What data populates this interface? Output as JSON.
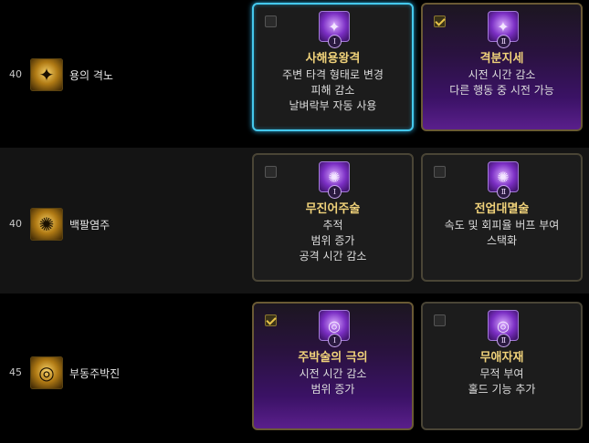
{
  "rows": [
    {
      "level": "40",
      "skill": "용의 격노",
      "icon": "dragon-icon",
      "options": [
        {
          "title": "사해용왕격",
          "numeral": "Ⅰ",
          "checked": false,
          "selected": true,
          "lines": [
            "주변 타격 형태로 변경",
            "피해 감소",
            "날벼락부 자동 사용"
          ]
        },
        {
          "title": "격분지세",
          "numeral": "Ⅱ",
          "checked": true,
          "selected": false,
          "lines": [
            "시전 시간 감소",
            "다른 행동 중 시전 가능"
          ]
        }
      ]
    },
    {
      "level": "40",
      "skill": "백팔염주",
      "icon": "prayer-beads-icon",
      "options": [
        {
          "title": "무진어주술",
          "numeral": "Ⅰ",
          "checked": false,
          "selected": false,
          "lines": [
            "추적",
            "범위 증가",
            "공격 시간 감소"
          ]
        },
        {
          "title": "전업대멸술",
          "numeral": "Ⅱ",
          "checked": false,
          "selected": false,
          "lines": [
            "속도 및 회피율 버프 부여",
            "스택화"
          ]
        }
      ]
    },
    {
      "level": "45",
      "skill": "부동주박진",
      "icon": "binding-circle-icon",
      "options": [
        {
          "title": "주박술의 극의",
          "numeral": "Ⅰ",
          "checked": true,
          "selected": false,
          "lines": [
            "시전 시간 감소",
            "범위 증가"
          ]
        },
        {
          "title": "무애자재",
          "numeral": "Ⅱ",
          "checked": false,
          "selected": false,
          "lines": [
            "무적 부여",
            "홀드 기능 추가"
          ]
        }
      ]
    }
  ]
}
